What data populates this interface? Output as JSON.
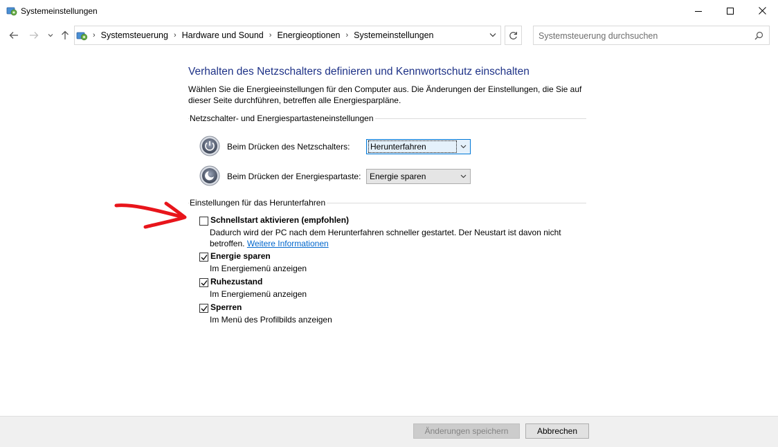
{
  "window": {
    "title": "Systemeinstellungen",
    "minimize_icon": "minimize-icon",
    "maximize_icon": "maximize-icon",
    "close_icon": "close-icon"
  },
  "nav": {
    "back_icon": "arrow-left-icon",
    "forward_icon": "arrow-right-icon",
    "recent_icon": "chevron-down-icon",
    "up_icon": "arrow-up-icon"
  },
  "address": {
    "crumbs": [
      "Systemsteuerung",
      "Hardware und Sound",
      "Energieoptionen",
      "Systemeinstellungen"
    ],
    "refresh_icon": "refresh-icon"
  },
  "search": {
    "placeholder": "Systemsteuerung durchsuchen",
    "icon": "search-icon"
  },
  "content": {
    "heading": "Verhalten des Netzschalters definieren und Kennwortschutz einschalten",
    "intro": "Wählen Sie die Energieeinstellungen für den Computer aus. Die Änderungen der Einstellungen, die Sie auf dieser Seite durchführen, betreffen alle Energiesparpläne.",
    "section_buttons": "Netzschalter- und Energiespartasteneinstellungen",
    "power_button_label": "Beim Drücken des Netzschalters:",
    "power_button_value": "Herunterfahren",
    "sleep_button_label": "Beim Drücken der Energiespartaste:",
    "sleep_button_value": "Energie sparen",
    "section_shutdown": "Einstellungen für das Herunterfahren",
    "options": [
      {
        "title": "Schnellstart aktivieren (empfohlen)",
        "desc": "Dadurch wird der PC nach dem Herunterfahren schneller gestartet. Der Neustart ist davon nicht",
        "desc2": "betroffen.",
        "link": "Weitere Informationen",
        "checked": false
      },
      {
        "title": "Energie sparen",
        "desc": "Im Energiemenü anzeigen",
        "checked": true
      },
      {
        "title": "Ruhezustand",
        "desc": "Im Energiemenü anzeigen",
        "checked": true
      },
      {
        "title": "Sperren",
        "desc": "Im Menü des Profilbilds anzeigen",
        "checked": true
      }
    ]
  },
  "footer": {
    "save_label": "Änderungen speichern",
    "cancel_label": "Abbrechen"
  },
  "colors": {
    "heading": "#1e3287",
    "link": "#0066cc",
    "annotation": "#e8151b"
  }
}
